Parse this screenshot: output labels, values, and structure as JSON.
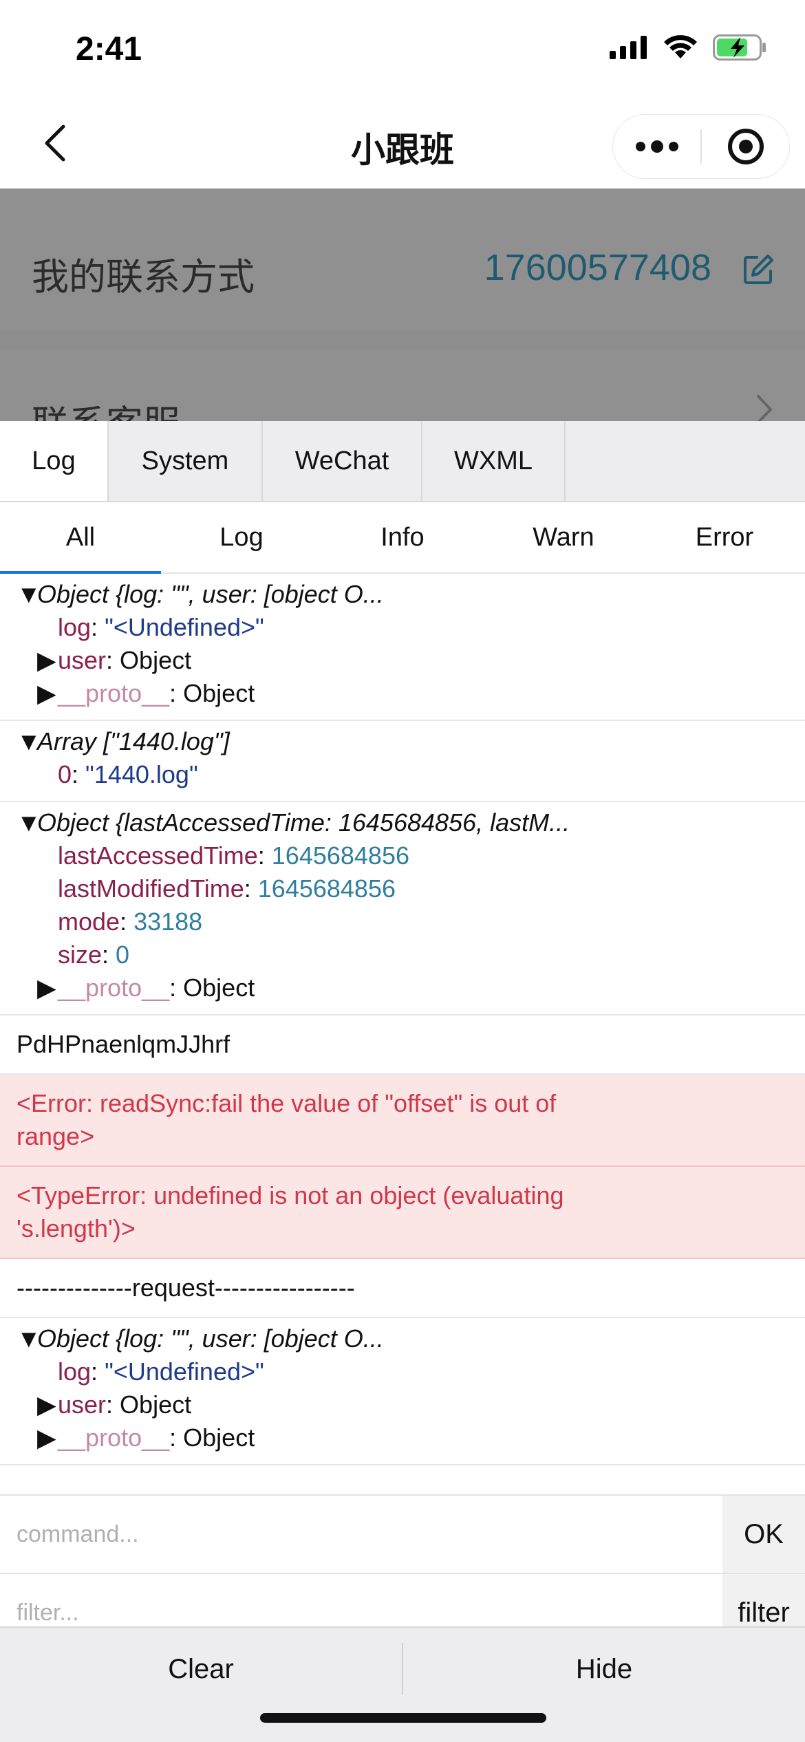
{
  "status_bar": {
    "time": "2:41"
  },
  "nav": {
    "title": "小跟班"
  },
  "page": {
    "contact_label": "我的联系方式",
    "contact_value": "17600577408",
    "support_label": "联系客服"
  },
  "console": {
    "tabs": [
      "Log",
      "System",
      "WeChat",
      "WXML"
    ],
    "subtabs": [
      "All",
      "Log",
      "Info",
      "Warn",
      "Error"
    ],
    "logs": {
      "e1": {
        "header": "Object {log: \"\", user: [object O...",
        "log_key": "log",
        "log_value": "\"<Undefined>\"",
        "user_key": "user",
        "user_value": "Object",
        "proto_key": "__proto__",
        "proto_value": "Object"
      },
      "e2": {
        "header": "Array [\"1440.log\"]",
        "k0": "0",
        "v0": "\"1440.log\""
      },
      "e3": {
        "header": "Object {lastAccessedTime: 1645684856, lastM...",
        "k1": "lastAccessedTime",
        "v1": "1645684856",
        "k2": "lastModifiedTime",
        "v2": "1645684856",
        "k3": "mode",
        "v3": "33188",
        "k4": "size",
        "v4": "0",
        "proto_key": "__proto__",
        "proto_value": "Object"
      },
      "e4": "PdHPnaenlqmJJhrf",
      "e5": {
        "l1": "<Error: readSync:fail the value of \"offset\" is out of",
        "l2": "range>"
      },
      "e6": {
        "l1": "<TypeError: undefined is not an object (evaluating",
        "l2": "'s.length')>"
      },
      "e7": "--------------request-----------------",
      "e8": {
        "header": "Object {log: \"\", user: [object O...",
        "log_key": "log",
        "log_value": "\"<Undefined>\"",
        "user_key": "user",
        "user_value": "Object",
        "proto_key": "__proto__",
        "proto_value": "Object"
      }
    },
    "command": {
      "placeholder": "command...",
      "ok_label": "OK"
    },
    "filter": {
      "placeholder": "filter...",
      "filter_label": "filter"
    },
    "footer": {
      "clear_label": "Clear",
      "hide_label": "Hide"
    }
  }
}
